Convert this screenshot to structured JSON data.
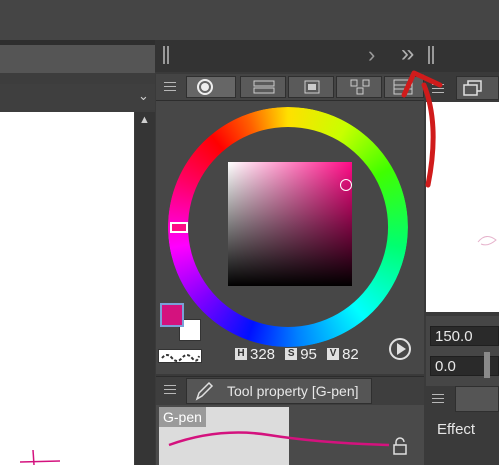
{
  "color_wheel": {
    "current_color": "#d4127e",
    "background_color": "#ffffff",
    "hsv": {
      "h_label": "H",
      "h": "328",
      "s_label": "S",
      "s": "95",
      "v_label": "V",
      "v": "82"
    }
  },
  "tool_property": {
    "tab_label": "Tool property [G-pen]",
    "preview_label": "G-pen",
    "stroke_color": "#d4127e"
  },
  "right_panel": {
    "field1": "150.0",
    "field2": "0.0",
    "effect_label": "Effect"
  },
  "dock": {
    "expand_glyph": "»",
    "next_glyph": "›"
  },
  "annotation": {
    "arrow_color": "#d01b1b"
  },
  "icons": [
    "menu-icon",
    "color-wheel-tab-icon",
    "color-set-tab-icon",
    "color-history-tab-icon",
    "intermediate-color-tab-icon",
    "approx-color-tab-icon",
    "pen-icon",
    "lock-icon",
    "play-icon",
    "layer-tab-icon",
    "scroll-up-icon",
    "chevron-down-icon"
  ]
}
